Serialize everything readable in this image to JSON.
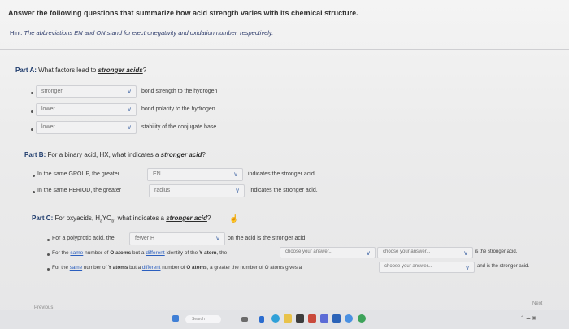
{
  "header": {
    "title": "Answer the following questions that summarize how acid strength varies with its chemical structure.",
    "hint_prefix": "Hint:",
    "hint": "The abbreviations EN and ON stand for electronegativity and oxidation number, respectively."
  },
  "partA": {
    "label": "Part A:",
    "question_pre": "What factors lead to",
    "question_u": "stronger acids",
    "question_post": "?",
    "rows": [
      {
        "value": "stronger",
        "desc": "bond strength to the hydrogen"
      },
      {
        "value": "lower",
        "desc": "bond polarity to the hydrogen"
      },
      {
        "value": "lower",
        "desc": "stability of the conjugate base"
      }
    ]
  },
  "partB": {
    "label": "Part B:",
    "question_pre": "For a binary acid, HX, what indicates a",
    "question_u": "stronger acid",
    "question_post": "?",
    "rows": [
      {
        "text": "In the same GROUP, the greater",
        "value": "EN",
        "desc": "indicates the stronger acid."
      },
      {
        "text": "In the same PERIOD, the greater",
        "value": "radius",
        "desc": "indicates the stronger acid."
      }
    ]
  },
  "partC": {
    "label": "Part C:",
    "question_pre": "For oxyacids, H",
    "question_sub1": "a",
    "question_mid": "YO",
    "question_sub2": "b",
    "question_mid2": ", what indicates a",
    "question_u": "stronger acid",
    "question_post": "?",
    "row1": {
      "text": "For a polyprotic acid, the",
      "value": "fewer H",
      "desc": "on the acid is the stronger acid."
    },
    "row2": {
      "t1": "For the",
      "t_u1": "same",
      "t2": "number of",
      "t_b1": "O atoms",
      "t3": "but a",
      "t_u2": "different",
      "t4": "identity of the",
      "t_b2": "Y atom",
      "t5": ", the",
      "value1": "choose your answer...",
      "value2": "choose your answer...",
      "desc": "is the stronger acid."
    },
    "row3": {
      "t1": "For the",
      "t_u1": "same",
      "t2": "number of",
      "t_b1": "Y atoms",
      "t3": "but a",
      "t_u2": "different",
      "t4": "number of",
      "t_b2": "O atoms",
      "t5": ", a greater the number of O atoms gives a",
      "value1": "choose your answer...",
      "desc": "and is the stronger acid."
    }
  },
  "nav": {
    "previous": "Previous",
    "next": "Next"
  },
  "taskbar": {
    "search_placeholder": "Search"
  }
}
